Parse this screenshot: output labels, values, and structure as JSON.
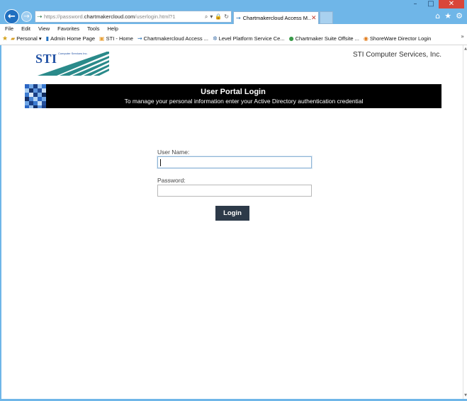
{
  "window": {
    "controls": {
      "minimize": "–",
      "maximize": "□",
      "close": "✕"
    }
  },
  "browser": {
    "address": {
      "url_prefix": "https://password.",
      "url_domain": "chartmakercloud.com",
      "url_path": "/userlogin.html?1",
      "tools": [
        "⌕",
        "▾",
        "🔒",
        "↻"
      ]
    },
    "tab": {
      "title": "Chartmakercloud Access M...",
      "close": "✕"
    },
    "right_icons": [
      "⌂",
      "★",
      "⚙"
    ],
    "menu": [
      "File",
      "Edit",
      "View",
      "Favorites",
      "Tools",
      "Help"
    ],
    "favorites": [
      {
        "label": "Personal ▾",
        "icon": "folder-icon"
      },
      {
        "label": "Admin Home Page",
        "icon": "page-icon"
      },
      {
        "label": "STI - Home",
        "icon": "site-icon"
      },
      {
        "label": "Chartmakercloud Access ...",
        "icon": "link-icon"
      },
      {
        "label": "Level Platform Service Ce...",
        "icon": "gear-icon"
      },
      {
        "label": "Chartmaker Suite Offsite ...",
        "icon": "globe-icon"
      },
      {
        "label": "ShoreWare Director Login",
        "icon": "site-icon"
      }
    ],
    "favorites_more": "»"
  },
  "page": {
    "logo_text": "STI",
    "logo_sub": "Computer Services Inc.",
    "company": "STI Computer Services, Inc.",
    "banner": {
      "title": "User Portal Login",
      "subtitle": "To manage your personal information enter your Active Directory authentication credential"
    },
    "form": {
      "username_label": "User Name:",
      "username_value": "",
      "password_label": "Password:",
      "password_value": "",
      "login_label": "Login"
    }
  },
  "colors": {
    "frame": "#6fb6e8",
    "banner_bg": "#000000",
    "button_bg": "#2d3a49",
    "logo_blue": "#1f4fa3",
    "logo_teal": "#2a8a8a"
  }
}
